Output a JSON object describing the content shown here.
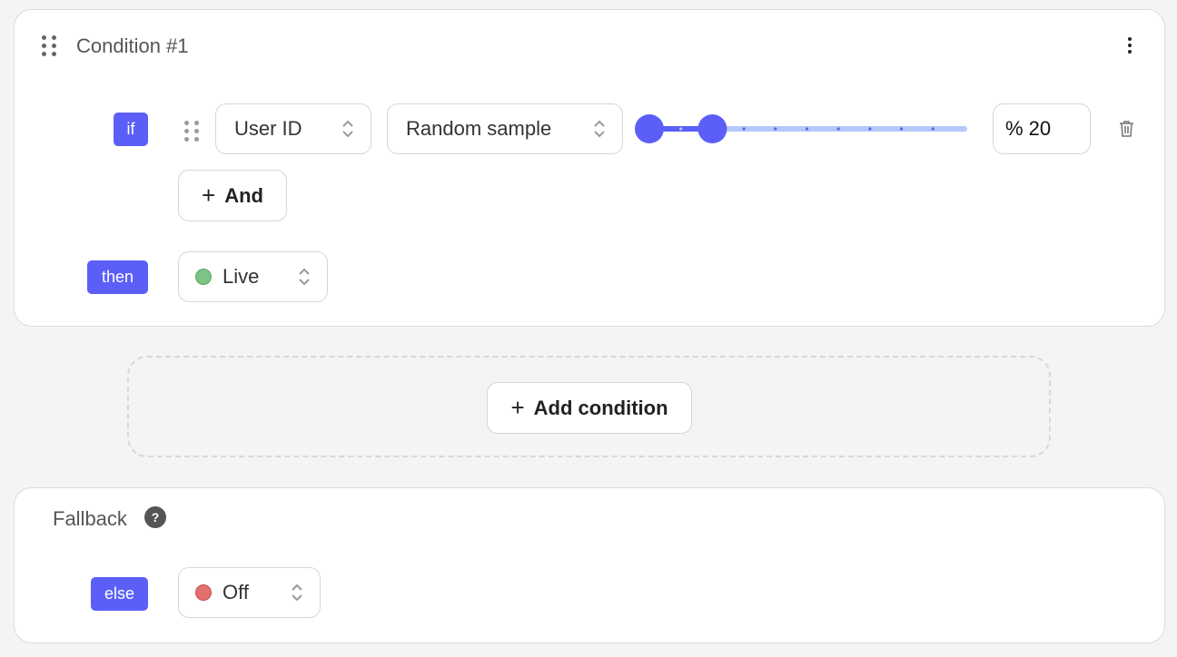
{
  "condition": {
    "title": "Condition #1",
    "if_label": "if",
    "attribute": "User ID",
    "operator": "Random sample",
    "slider": {
      "min": 0,
      "max": 100,
      "step": 10,
      "range": [
        0,
        20
      ]
    },
    "percent_value": "% 20",
    "and_label": "And",
    "then_label": "then",
    "then_value": "Live",
    "then_color": "#7dc383"
  },
  "add_condition_label": "Add condition",
  "fallback": {
    "title": "Fallback",
    "else_label": "else",
    "else_value": "Off",
    "else_color": "#e36f6f"
  },
  "colors": {
    "accent": "#5b5ff7",
    "track": "#b4c8fb"
  }
}
